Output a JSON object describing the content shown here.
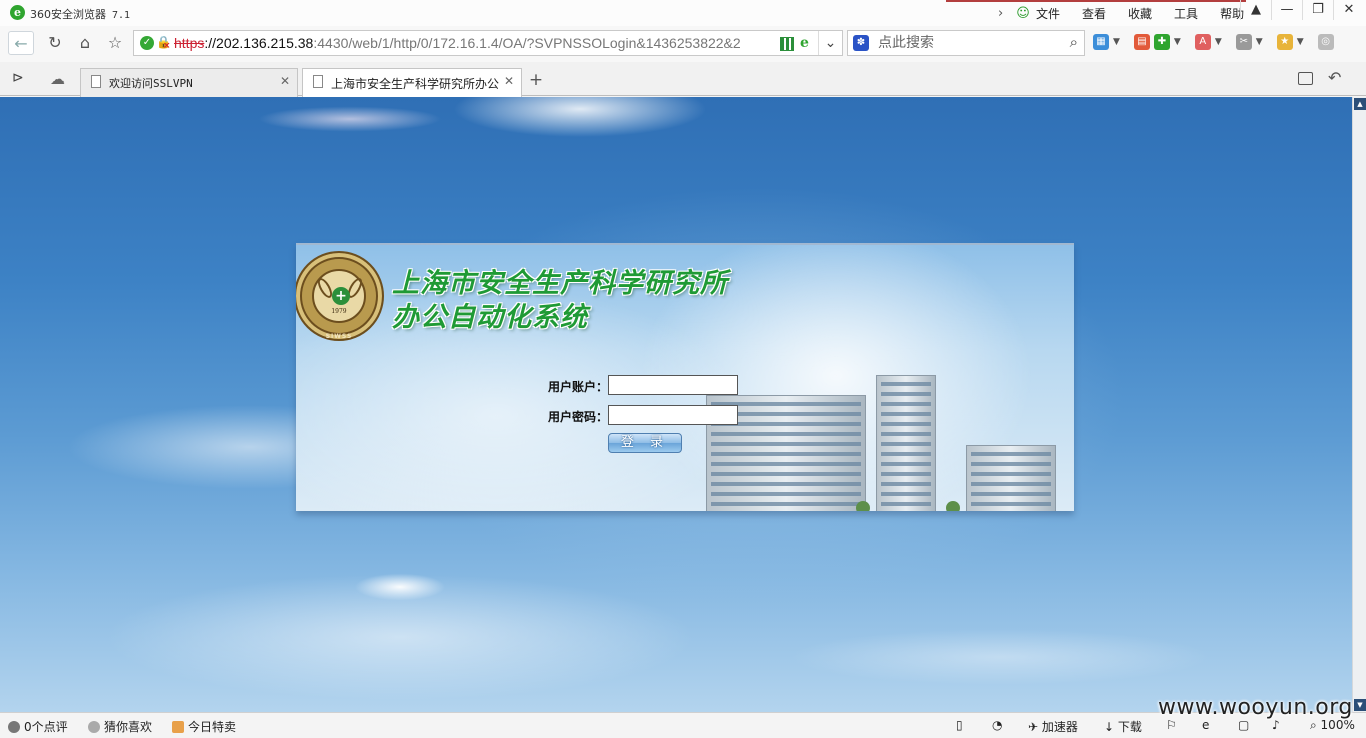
{
  "browser": {
    "title": "360安全浏览器",
    "version": "7.1",
    "menu": [
      "文件",
      "查看",
      "收藏",
      "工具",
      "帮助"
    ],
    "window_controls": [
      "shirt-icon",
      "minimize-icon",
      "restore-icon",
      "close-icon"
    ]
  },
  "address": {
    "scheme": "https",
    "host": "://202.136.215.38",
    "rest": ":4430/web/1/http/0/172.16.1.4/OA/?SVPNSSOLogin&1436253822&2"
  },
  "search": {
    "placeholder": "点此搜索"
  },
  "tabs": [
    {
      "label": "欢迎访问SSLVPN",
      "active": false
    },
    {
      "label": "上海市安全生产科学研究所办公",
      "active": true
    }
  ],
  "page": {
    "title_line1": "上海市安全生产科学研究所",
    "title_line2": "办公自动化系统",
    "emblem_year": "1979",
    "emblem_abbr": "SIWSS",
    "account_label": "用户账户：",
    "password_label": "用户密码：",
    "login_button": "登 录"
  },
  "statusbar": {
    "reviews": "0个点评",
    "guess": "猜你喜欢",
    "deals": "今日特卖",
    "accelerator": "加速器",
    "download": "下载",
    "zoom": "100%"
  },
  "watermark": "www.wooyun.org"
}
